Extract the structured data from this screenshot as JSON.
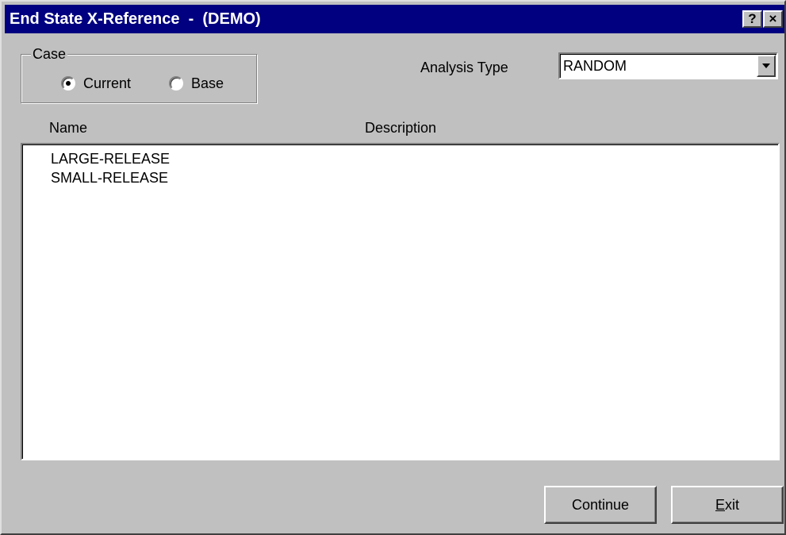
{
  "window": {
    "title": "End State X-Reference  -  (DEMO)",
    "help_label": "?",
    "close_label": "×"
  },
  "case": {
    "legend": "Case",
    "options": [
      {
        "label": "Current",
        "selected": true
      },
      {
        "label": "Base",
        "selected": false
      }
    ]
  },
  "analysis": {
    "label": "Analysis Type",
    "value": "RANDOM"
  },
  "columns": {
    "name": "Name",
    "description": "Description"
  },
  "items": [
    {
      "name": "LARGE-RELEASE",
      "description": ""
    },
    {
      "name": "SMALL-RELEASE",
      "description": ""
    }
  ],
  "buttons": {
    "continue_label": "Continue",
    "exit_mnemonic": "E",
    "exit_rest": "xit"
  },
  "icons": {
    "help": "help-icon",
    "close": "close-icon",
    "dropdown": "chevron-down-icon"
  }
}
